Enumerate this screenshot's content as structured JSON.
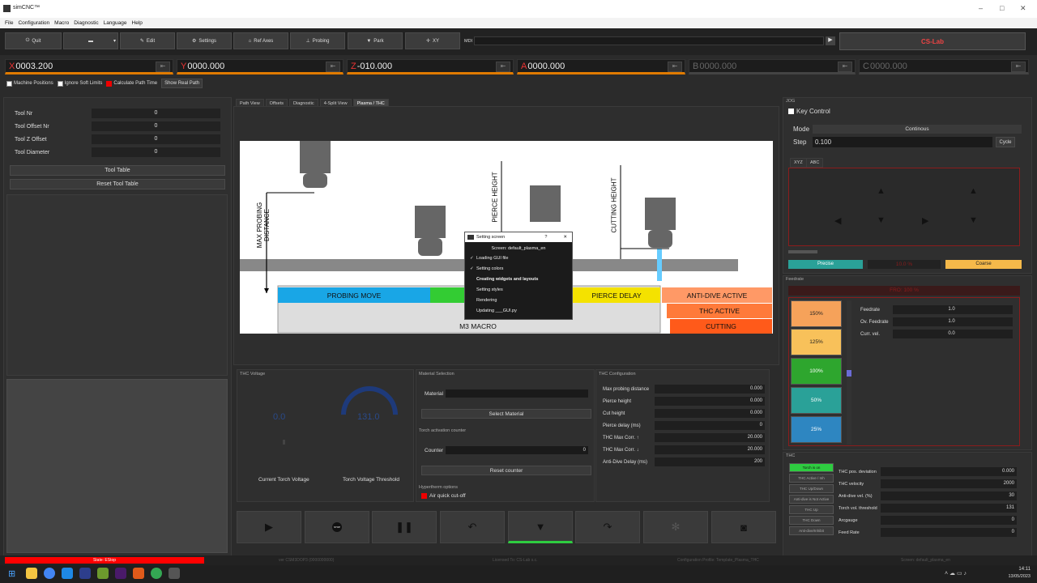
{
  "window": {
    "title": "simCNC™"
  },
  "menu": [
    "File",
    "Configuration",
    "Macro",
    "Diagnostic",
    "Language",
    "Help"
  ],
  "toolbar": {
    "quit": "Quit",
    "edit": "Edit",
    "settings": "Settings",
    "ref_axes": "Ref Axes",
    "probing": "Probing",
    "park": "Park",
    "xy": "XY",
    "mdi_label": "MDI",
    "logo": "CS-Lab"
  },
  "axes": [
    {
      "letter": "X",
      "value": "0003.200"
    },
    {
      "letter": "Y",
      "value": "0000.000"
    },
    {
      "letter": "Z",
      "value": "-010.000"
    },
    {
      "letter": "A",
      "value": "0000.000"
    },
    {
      "letter": "B",
      "value": "0000.000"
    },
    {
      "letter": "C",
      "value": "0000.000"
    }
  ],
  "options": {
    "machine_positions": "Machine Positions",
    "ignore_soft_limits": "Ignore Soft Limits",
    "calc_path_time": "Calculate Path Time",
    "show_real_path": "Show Real Path"
  },
  "tool": {
    "nr_label": "Tool Nr",
    "nr": "0",
    "offset_nr_label": "Tool Offset Nr",
    "offset_nr": "0",
    "z_offset_label": "Tool Z Offset",
    "z_offset": "0",
    "diameter_label": "Tool Diameter",
    "diameter": "0",
    "tool_table": "Tool Table",
    "reset_tool_table": "Reset Tool Table"
  },
  "tabs": [
    "Path View",
    "Offsets",
    "Diagnostic",
    "4-Split View",
    "Plasma / THC"
  ],
  "diagram": {
    "max_probing": "MAX PROBING DISTANCE",
    "pierce_height": "PIERCE HEIGHT",
    "cutting_height": "CUTTING HEIGHT",
    "probing_move": "PROBING MOVE",
    "pierce_delay": "PIERCE DELAY",
    "anti_dive": "ANTI-DIVE ACTIVE",
    "thc_active": "THC ACTIVE",
    "cutting": "CUTTING",
    "m3_macro": "M3 MACRO"
  },
  "dialog": {
    "title": "Setting screen",
    "screen": "Screen: default_plasma_en",
    "items": [
      {
        "text": "Loading GUI file",
        "done": true,
        "bold": false
      },
      {
        "text": "Setting colors",
        "done": true,
        "bold": false
      },
      {
        "text": "Creating widgets and layouts",
        "done": false,
        "bold": true
      },
      {
        "text": "Setting styles",
        "done": false,
        "bold": false
      },
      {
        "text": "Rendering",
        "done": false,
        "bold": false
      },
      {
        "text": "Updating ___GUI.py",
        "done": false,
        "bold": false
      }
    ]
  },
  "thc_voltage": {
    "header": "THC Voltage",
    "current_value": "0.0",
    "threshold_value": "131.0",
    "current_label": "Current Torch Voltage",
    "threshold_label": "Torch Voltage Threshold"
  },
  "material": {
    "header": "Material Selection",
    "label": "Material",
    "select_button": "Select Material",
    "counter_header": "Torch activation counter",
    "counter_label": "Counter",
    "counter_value": "0",
    "reset_counter": "Reset counter",
    "hypertherm_header": "Hypertherm options",
    "air_cutoff": "Air quick cut-off"
  },
  "thc_config": {
    "header": "THC Configuration",
    "rows": [
      {
        "label": "Max probing distance",
        "value": "0.000"
      },
      {
        "label": "Pierce height",
        "value": "0.000"
      },
      {
        "label": "Cut height",
        "value": "0.000"
      },
      {
        "label": "Pierce delay (ms)",
        "value": "0"
      },
      {
        "label": "THC Max Corr. ↑",
        "value": "20.000"
      },
      {
        "label": "THC Max Corr. ↓",
        "value": "20.000"
      },
      {
        "label": "Anti-Dive Delay (ms)",
        "value": "200"
      }
    ]
  },
  "jog": {
    "header": "JOG",
    "key_control": "Key Control",
    "mode_label": "Mode",
    "mode_value": "Continous",
    "step_label": "Step",
    "step_value": "0.100",
    "cycle": "Cycle",
    "tab_xyz": "XYZ",
    "tab_abc": "ABC",
    "precise": "Precise",
    "jog_percent": "10.0 %",
    "coarse": "Coarse"
  },
  "feedrate": {
    "header": "Feedrate",
    "fro": "FRO: 100 %",
    "buttons": [
      "150%",
      "125%",
      "100%",
      "50%",
      "25%"
    ],
    "feedrate_label": "Feedrate",
    "feedrate_value": "1.0",
    "ov_label": "Ov. Feedrate",
    "ov_value": "1.0",
    "curr_label": "Curr. vel.",
    "curr_value": "0.0"
  },
  "thc": {
    "header": "THC",
    "buttons": [
      "Torch is on",
      "THC Active / Inh",
      "THC Up/Down",
      "Anti-dive is Not Active",
      "THC Up",
      "THC Down",
      "Anti-dive/Inhibit"
    ],
    "rows": [
      {
        "label": "THC pos. deviation",
        "value": "0.000"
      },
      {
        "label": "THC velocity",
        "value": "2000"
      },
      {
        "label": "Anti-dive vel. (%)",
        "value": "30"
      },
      {
        "label": "Torch vol. threshold",
        "value": "131"
      },
      {
        "label": "Arcgauge",
        "value": "0"
      },
      {
        "label": "Feed Rate",
        "value": "0"
      }
    ]
  },
  "status": {
    "estop": "State: EStop",
    "version": "ver CSM3DOP3 (0000000000)",
    "license": "Licensed To: CS-Lab s.c.",
    "config": "Configuration Profile: Template_Plasma_THC",
    "screen": "Screen: default_plasma_en"
  },
  "taskbar": {
    "time": "14:11",
    "date": "13/05/2023"
  },
  "colors": {
    "axis_underline": "#e07b00",
    "estop": "#ff0000",
    "precise": "#2aa198",
    "coarse": "#f5b94a"
  }
}
